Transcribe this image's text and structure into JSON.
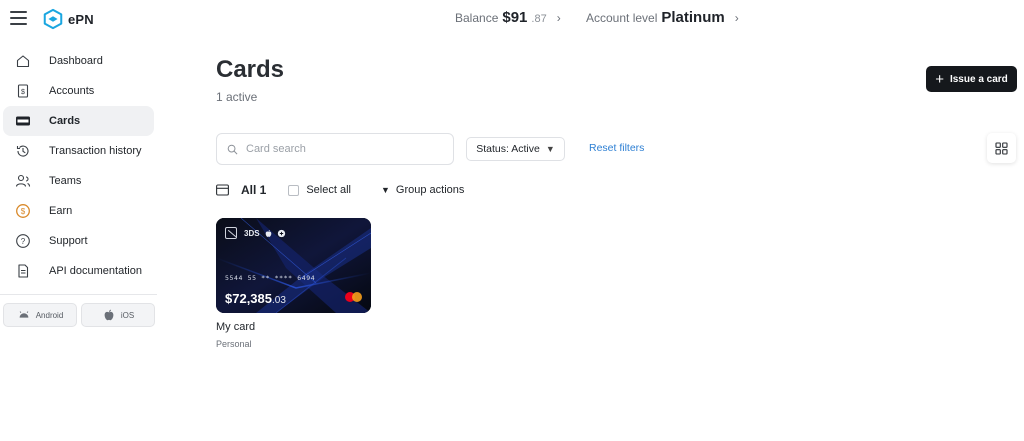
{
  "brand": {
    "name": "ePN"
  },
  "header": {
    "balance_label": "Balance",
    "balance_whole": "$91",
    "balance_cents": ".87",
    "account_level_label": "Account level",
    "account_level_value": "Platinum"
  },
  "sidebar": {
    "items": [
      {
        "label": "Dashboard",
        "icon": "home-icon",
        "active": false
      },
      {
        "label": "Accounts",
        "icon": "document-dollar-icon",
        "active": false
      },
      {
        "label": "Cards",
        "icon": "card-icon",
        "active": true
      },
      {
        "label": "Transaction history",
        "icon": "history-icon",
        "active": false
      },
      {
        "label": "Teams",
        "icon": "users-icon",
        "active": false
      },
      {
        "label": "Earn",
        "icon": "coin-icon",
        "active": false
      },
      {
        "label": "Support",
        "icon": "help-icon",
        "active": false
      },
      {
        "label": "API documentation",
        "icon": "file-icon",
        "active": false
      }
    ],
    "apps": {
      "android": "Android",
      "ios": "iOS"
    }
  },
  "main": {
    "title": "Cards",
    "subtitle": "1 active",
    "issue_button": "Issue a card",
    "search_placeholder": "Card search",
    "status_filter": "Status: Active",
    "reset_filters": "Reset filters",
    "all_label": "All 1",
    "select_all": "Select all",
    "group_actions": "Group actions"
  },
  "cards": [
    {
      "badge": "3DS",
      "number": "5544 55 ** **** 6494",
      "balance_whole": "$72,385",
      "balance_cents": ".03",
      "name": "My card",
      "type": "Personal",
      "network": "mastercard"
    }
  ],
  "colors": {
    "accent_link": "#2d7fd3",
    "primary_button": "#15181c",
    "brand": "#1aa6e0"
  }
}
